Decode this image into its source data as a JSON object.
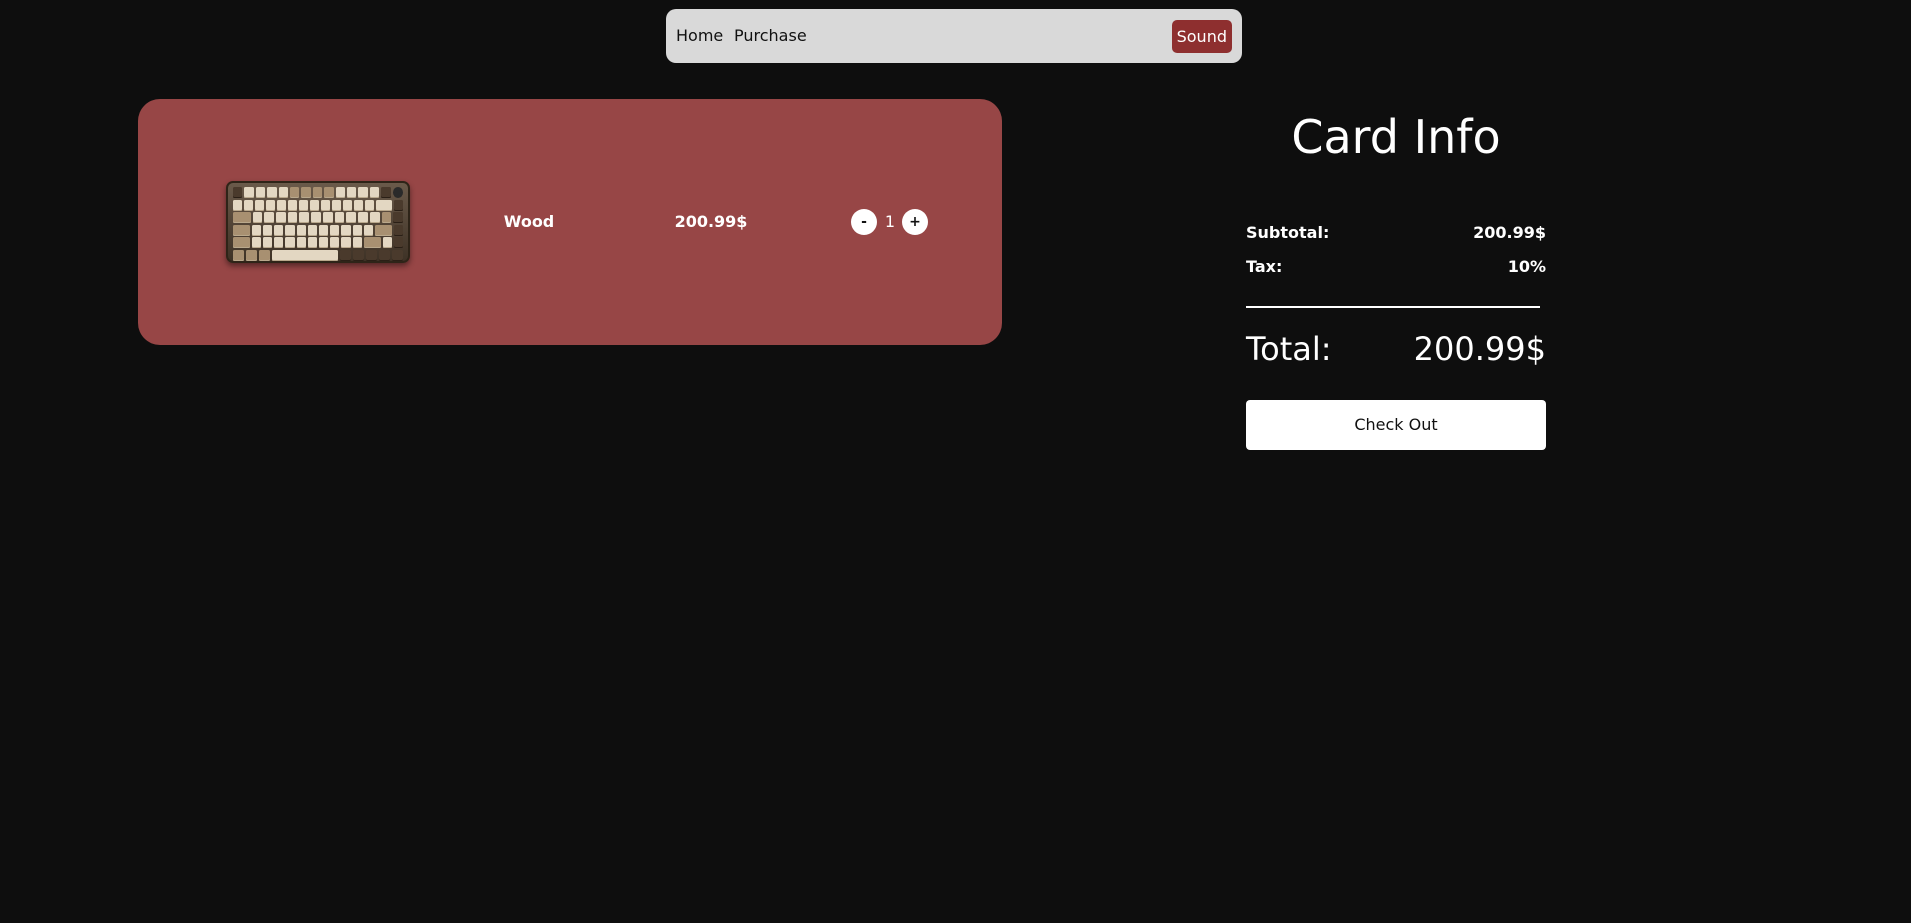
{
  "nav": {
    "home": "Home",
    "purchase": "Purchase",
    "sound": "Sound"
  },
  "cart": {
    "items": [
      {
        "image": "keyboard-product-image",
        "name": "Wood",
        "price": "200.99$",
        "quantity": "1",
        "minus_label": "-",
        "plus_label": "+"
      }
    ]
  },
  "summary": {
    "title": "Card Info",
    "subtotal_label": "Subtotal:",
    "subtotal_value": "200.99$",
    "tax_label": "Tax:",
    "tax_value": "10%",
    "total_label": "Total:",
    "total_value": "200.99$",
    "checkout_label": "Check Out"
  },
  "colors": {
    "background": "#0e0e0e",
    "navbar": "#d9d9d9",
    "accent": "#8e2f2f",
    "card": "#974646",
    "text": "#ffffff",
    "button": "#ffffff"
  }
}
